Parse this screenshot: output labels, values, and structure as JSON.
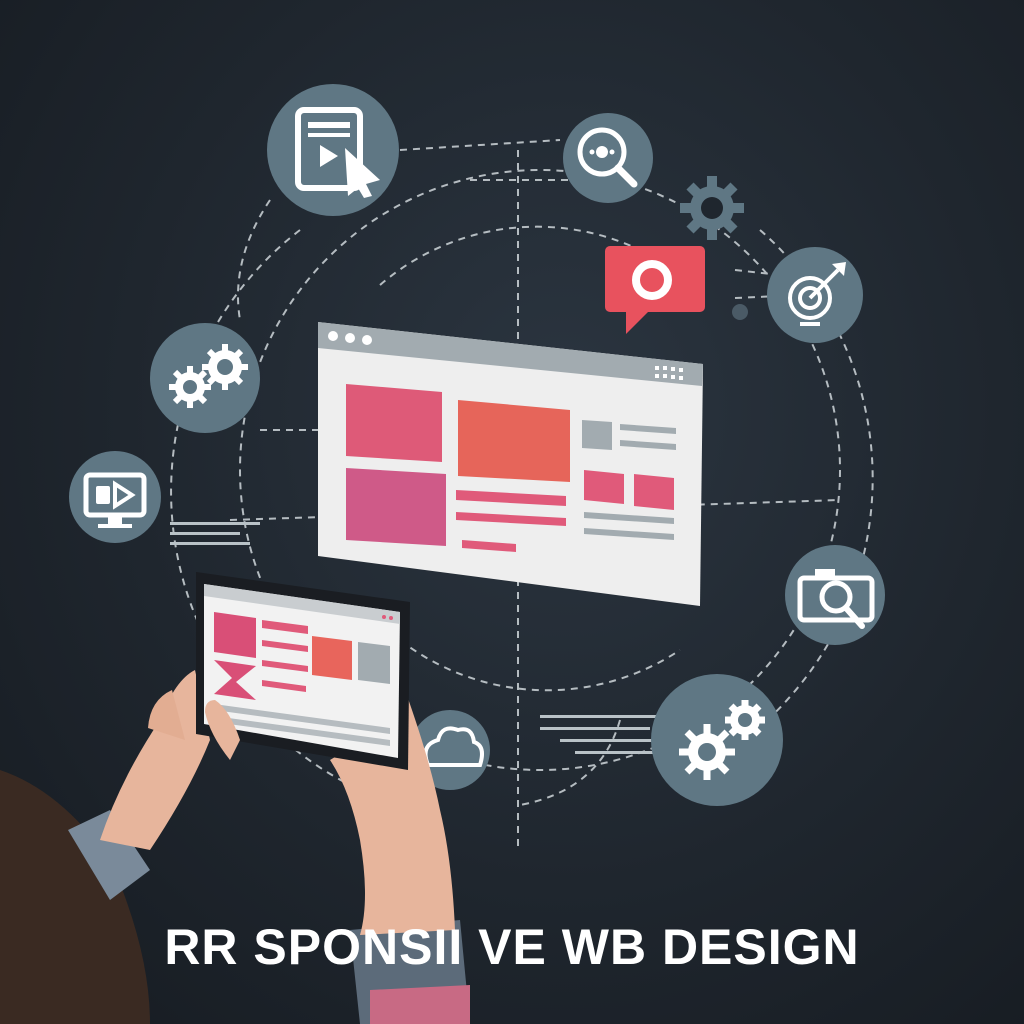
{
  "caption": "RR SPONSII VE WB DESIGN",
  "colors": {
    "background": "#1f262e",
    "icon_circle": "#5f7784",
    "accent_pink": "#e05a7a",
    "accent_coral": "#e8655c",
    "browser_panel": "#f1f1f1",
    "browser_bar": "#9aa3a8",
    "chat_bubble": "#e8525e"
  },
  "icons": [
    "tablet-video-icon",
    "search-eye-icon",
    "gear-icon",
    "chat-bubble-icon",
    "target-icon",
    "gears-icon",
    "video-monitor-icon",
    "camera-search-icon",
    "cloud-icon",
    "gears-bottom-icon"
  ]
}
